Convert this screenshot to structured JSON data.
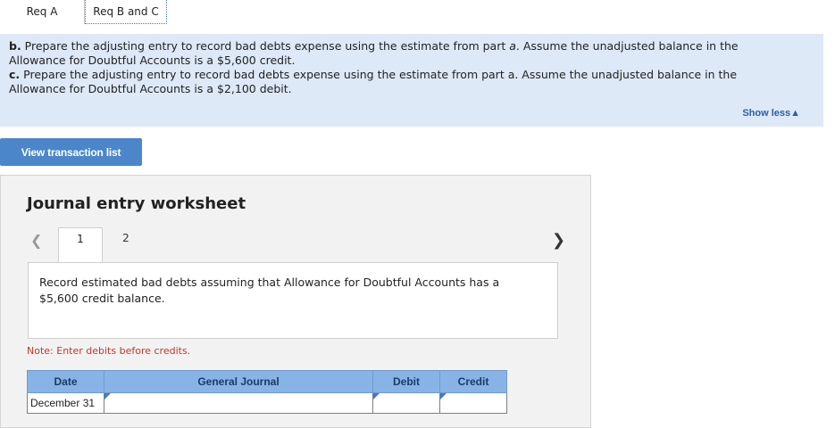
{
  "tabs": [
    {
      "label": "Req A"
    },
    {
      "label": "Req B and C"
    }
  ],
  "instructions": {
    "b_prefix": "b.",
    "b_text": " Prepare the adjusting entry to record bad debts expense using the estimate from part ",
    "b_part": "a",
    "b_text2": ". Assume the unadjusted balance in the Allowance for Doubtful Accounts is a $5,600 credit.",
    "c_prefix": "c.",
    "c_text": " Prepare the adjusting entry to record bad debts expense using the estimate from part a. Assume the unadjusted balance in the Allowance for Doubtful Accounts is a $2,100 debit.",
    "show_less": "Show less"
  },
  "view_button": "View transaction list",
  "worksheet": {
    "title": "Journal entry worksheet",
    "pages": [
      "1",
      "2"
    ],
    "description": "Record estimated bad debts assuming that Allowance for Doubtful Accounts has a $5,600 credit balance.",
    "note": "Note: Enter debits before credits.",
    "columns": [
      "Date",
      "General Journal",
      "Debit",
      "Credit"
    ],
    "rows": [
      {
        "date": "December 31",
        "account": "",
        "debit": "",
        "credit": ""
      }
    ]
  },
  "colors": {
    "panel_bg": "#dde9f7",
    "button_bg": "#4a86c9",
    "header_bg": "#87b3e6",
    "note_red": "#c0392b"
  }
}
